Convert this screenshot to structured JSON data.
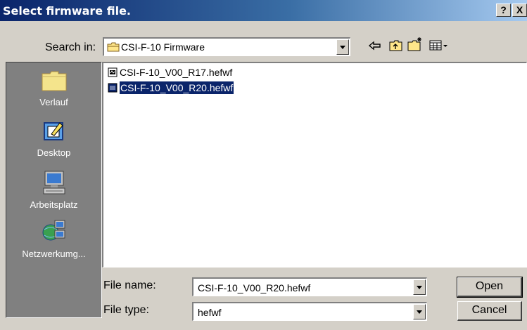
{
  "title": "Select firmware file.",
  "titlebar_buttons": {
    "help": "?",
    "close": "X"
  },
  "search_in": {
    "label": "Search in:",
    "value": "CSI-F-10 Firmware"
  },
  "toolbar": {
    "icons": [
      "back-icon",
      "up-folder-icon",
      "new-folder-icon",
      "view-menu-icon"
    ]
  },
  "places": [
    {
      "label": "Verlauf",
      "icon": "history-folder-icon"
    },
    {
      "label": "Desktop",
      "icon": "desktop-icon"
    },
    {
      "label": "Arbeitsplatz",
      "icon": "my-computer-icon"
    },
    {
      "label": "Netzwerkumg...",
      "icon": "network-icon"
    }
  ],
  "files": [
    {
      "name": "CSI-F-10_V00_R17.hefwf",
      "selected": false
    },
    {
      "name": "CSI-F-10_V00_R20.hefwf",
      "selected": true
    }
  ],
  "file_name": {
    "label": "File name:",
    "value": "CSI-F-10_V00_R20.hefwf"
  },
  "file_type": {
    "label": "File type:",
    "value": "hefwf"
  },
  "buttons": {
    "open": "Open",
    "cancel": "Cancel"
  }
}
